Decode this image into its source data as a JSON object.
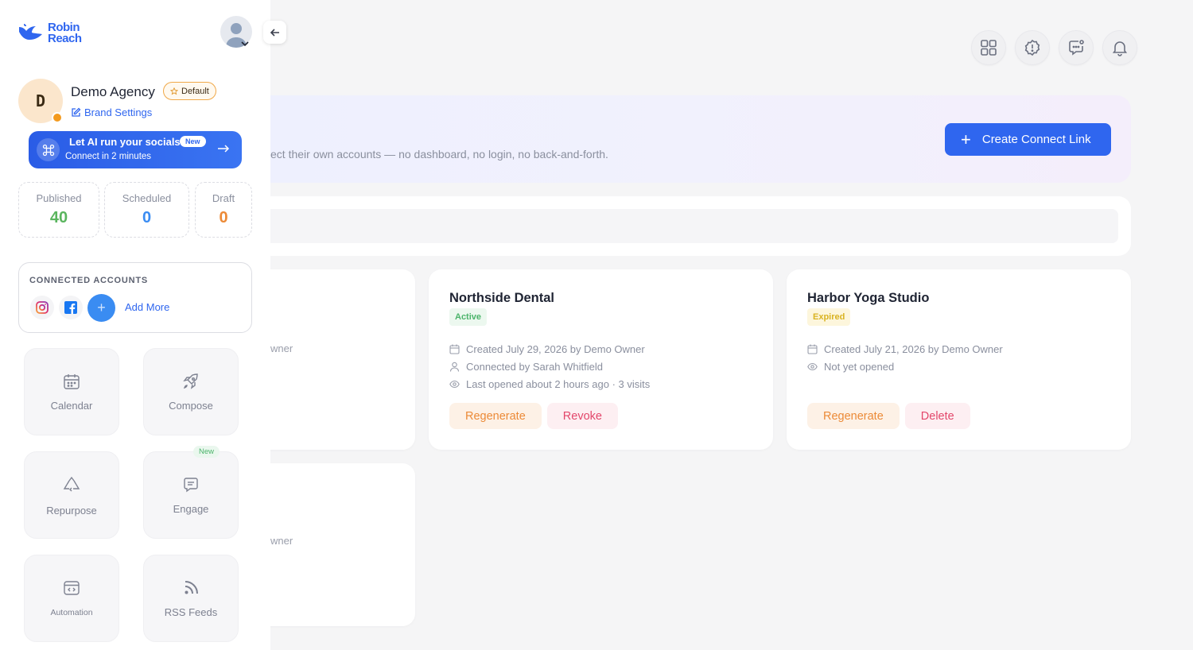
{
  "sidebar": {
    "logo_line1": "Robin",
    "logo_line2": "Reach",
    "brand": {
      "initial": "D",
      "name": "Demo Agency",
      "default_badge": "Default",
      "settings_link": "Brand Settings"
    },
    "ai_promo": {
      "title": "Let AI run your socials",
      "badge": "New",
      "subtitle": "Connect in 2 minutes"
    },
    "stats": [
      {
        "label": "Published",
        "value": "40",
        "color": "#5ab55e"
      },
      {
        "label": "Scheduled",
        "value": "0",
        "color": "#3a8cf2"
      },
      {
        "label": "Draft",
        "value": "0",
        "color": "#ec8a37"
      }
    ],
    "connected_accounts": {
      "title": "CONNECTED ACCOUNTS",
      "accounts": [
        "instagram-icon",
        "facebook-icon"
      ],
      "add_more": "Add More"
    },
    "tiles": [
      {
        "label": "Calendar",
        "icon": "calendar-icon"
      },
      {
        "label": "Compose",
        "icon": "rocket-icon"
      },
      {
        "label": "Repurpose",
        "icon": "recycle-icon"
      },
      {
        "label": "Engage",
        "icon": "chat-icon",
        "badge": "New"
      },
      {
        "label": "Automation",
        "icon": "code-window-icon"
      },
      {
        "label": "RSS Feeds",
        "icon": "rss-icon"
      }
    ]
  },
  "topbar": {
    "icons": [
      "apps-grid-icon",
      "alert-badge-icon",
      "support-chat-icon",
      "bell-icon"
    ]
  },
  "banner": {
    "subtitle_visible": "ect their own accounts — no dashboard, no login, no back-and-forth.",
    "create_button": "Create Connect Link"
  },
  "cards": [
    {
      "title": "Northside Dental",
      "status": "Active",
      "created": "Created July 29, 2026 by Demo Owner",
      "connected_by": "Connected by Sarah Whitfield",
      "last_opened": "Last opened about 2 hours ago · 3 visits",
      "buttons": [
        "Regenerate",
        "Revoke"
      ]
    },
    {
      "title": "Harbor Yoga Studio",
      "status": "Expired",
      "created": "Created July 21, 2026 by Demo Owner",
      "opened": "Not yet opened",
      "buttons": [
        "Regenerate",
        "Delete"
      ]
    }
  ],
  "partial_cards": {
    "left_top_fragment": "wner",
    "left_bottom_fragment": "wner"
  },
  "colors": {
    "primary": "#2f66ef",
    "active_green": "#4bb46a",
    "expired_yellow": "#d9b322",
    "regenerate_orange": "#ec8a37",
    "revoke_red": "#e3476b"
  }
}
